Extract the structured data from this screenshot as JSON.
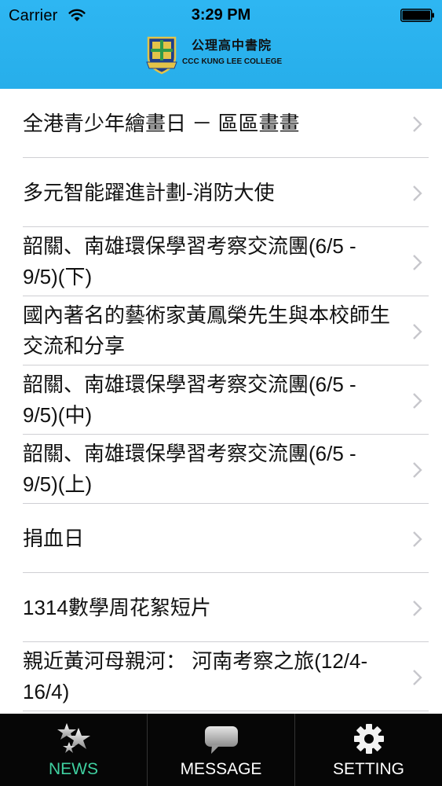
{
  "status_bar": {
    "carrier": "Carrier",
    "time": "3:29 PM"
  },
  "header": {
    "logo_name": "公理高中書院",
    "logo_sub": "CCC KUNG LEE COLLEGE",
    "color": "#2eb6f2"
  },
  "news": [
    {
      "title": "全港青少年繪畫日 － 區區畫畫"
    },
    {
      "title": "多元智能躍進計劃-消防大使"
    },
    {
      "title": "韶關、南雄環保學習考察交流團(6/5 - 9/5)(下)"
    },
    {
      "title": "國內著名的藝術家黃鳳榮先生與本校師生交流和分享"
    },
    {
      "title": "韶關、南雄環保學習考察交流團(6/5 - 9/5)(中)"
    },
    {
      "title": "韶關、南雄環保學習考察交流團(6/5 - 9/5)(上)"
    },
    {
      "title": "捐血日"
    },
    {
      "title": "1314數學周花絮短片"
    },
    {
      "title": "親近黃河母親河： 河南考察之旅(12/4-16/4)"
    }
  ],
  "tabs": [
    {
      "label": "NEWS",
      "icon": "stars-icon",
      "active": true
    },
    {
      "label": "MESSAGE",
      "icon": "speech-bubble-icon",
      "active": false
    },
    {
      "label": "SETTING",
      "icon": "gear-icon",
      "active": false
    }
  ],
  "colors": {
    "active_tab": "#3fd0a0",
    "tabbar_bg": "#060606"
  }
}
